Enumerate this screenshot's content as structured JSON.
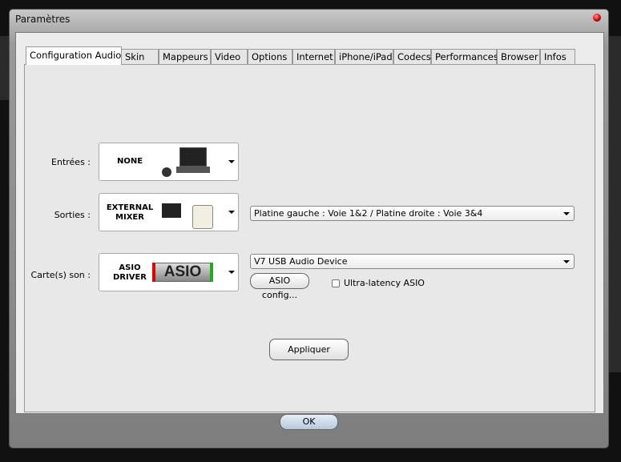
{
  "window": {
    "title": "Paramètres"
  },
  "tabs": [
    {
      "label": "Configuration Audio",
      "active": true
    },
    {
      "label": "Skin"
    },
    {
      "label": "Mappeurs"
    },
    {
      "label": "Video"
    },
    {
      "label": "Options"
    },
    {
      "label": "Internet"
    },
    {
      "label": "iPhone/iPad"
    },
    {
      "label": "Codecs"
    },
    {
      "label": "Performances"
    },
    {
      "label": "Browser"
    },
    {
      "label": "Infos"
    }
  ],
  "audio": {
    "inputs": {
      "label": "Entrées :",
      "value": "NONE"
    },
    "outputs": {
      "label": "Sorties :",
      "value_line1": "EXTERNAL",
      "value_line2": "MIXER",
      "routing": "Platine gauche : Voie 1&2 / Platine droite : Voie 3&4"
    },
    "soundcard": {
      "label": "Carte(s) son :",
      "value_line1": "ASIO",
      "value_line2": "DRIVER",
      "logo_text": "ASIO",
      "device": "V7 USB Audio Device",
      "config_button": "ASIO config...",
      "ultra_latency_label": "Ultra-latency ASIO",
      "ultra_latency_checked": false
    },
    "apply_button": "Appliquer"
  },
  "footer": {
    "ok_button": "OK"
  }
}
